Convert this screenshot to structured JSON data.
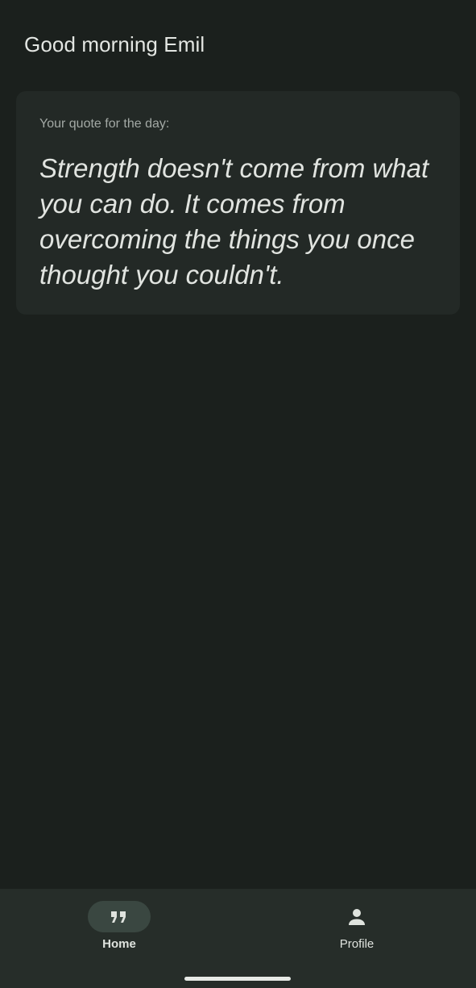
{
  "header": {
    "greeting": "Good morning Emil"
  },
  "quote_card": {
    "label": "Your quote for the day:",
    "quote": "Strength doesn't come from what you can do. It comes from overcoming the things you once thought you couldn't."
  },
  "bottom_nav": {
    "items": [
      {
        "label": "Home",
        "icon": "format-quote-icon",
        "selected": true
      },
      {
        "label": "Profile",
        "icon": "person-icon",
        "selected": false
      }
    ]
  },
  "colors": {
    "background": "#1b201d",
    "card": "#232926",
    "nav_bar": "#262d29",
    "nav_indicator": "#3a4741",
    "text_primary": "#e3e6e2",
    "text_secondary": "#a3a9a5"
  }
}
